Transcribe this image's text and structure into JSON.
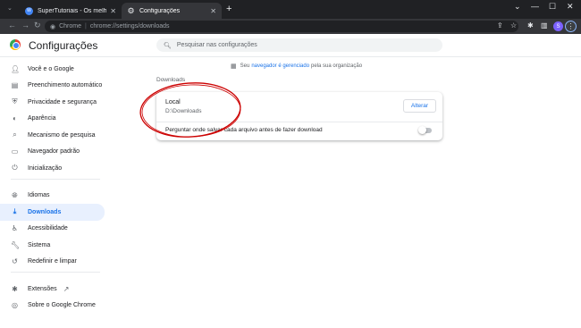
{
  "tabs": [
    {
      "title": "SuperTutoriais - Os melhores tu",
      "active": false
    },
    {
      "title": "Configurações",
      "active": true
    }
  ],
  "omnibox": {
    "scheme": "Chrome",
    "url": "chrome://settings/downloads"
  },
  "header": {
    "title": "Configurações",
    "search_placeholder": "Pesquisar nas configurações"
  },
  "sidebar": {
    "items": [
      {
        "label": "Você e o Google",
        "icon": "person-icon"
      },
      {
        "label": "Preenchimento automático",
        "icon": "clipboard-icon"
      },
      {
        "label": "Privacidade e segurança",
        "icon": "shield-icon"
      },
      {
        "label": "Aparência",
        "icon": "palette-icon"
      },
      {
        "label": "Mecanismo de pesquisa",
        "icon": "search-icon"
      },
      {
        "label": "Navegador padrão",
        "icon": "browser-icon"
      },
      {
        "label": "Inicialização",
        "icon": "power-icon"
      },
      {
        "label": "Idiomas",
        "icon": "globe-icon"
      },
      {
        "label": "Downloads",
        "icon": "download-icon",
        "selected": true
      },
      {
        "label": "Acessibilidade",
        "icon": "accessibility-icon"
      },
      {
        "label": "Sistema",
        "icon": "wrench-icon"
      },
      {
        "label": "Redefinir e limpar",
        "icon": "history-icon"
      },
      {
        "label": "Extensões",
        "icon": "puzzle-icon"
      },
      {
        "label": "Sobre o Google Chrome",
        "icon": "chrome-icon"
      }
    ]
  },
  "managed": {
    "prefix": "Seu",
    "link": "navegador é gerenciado",
    "suffix": "pela sua organização"
  },
  "downloads": {
    "section_title": "Downloads",
    "location_label": "Local",
    "location_value": "D:\\Downloads",
    "change_button": "Alterar",
    "ask_label": "Perguntar onde salvar cada arquivo antes de fazer download",
    "ask_enabled": false
  },
  "colors": {
    "accent": "#1a73e8",
    "annotation": "#cc0000"
  }
}
